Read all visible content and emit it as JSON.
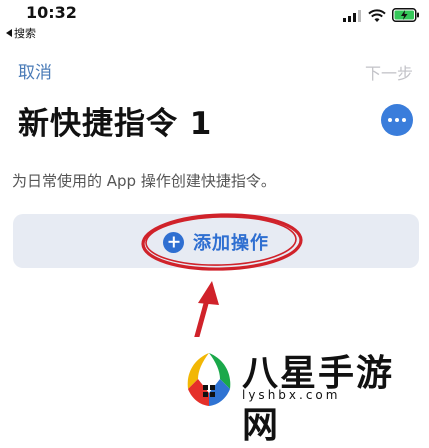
{
  "status_bar": {
    "time": "10:32",
    "back_label": "搜索"
  },
  "nav": {
    "cancel_label": "取消",
    "next_label": "下一步"
  },
  "page": {
    "title": "新快捷指令 1",
    "description": "为日常使用的 App 操作创建快捷指令。"
  },
  "action": {
    "add_label": "添加操作"
  },
  "watermark": {
    "name": "八星手游网",
    "url": "lyshbx.com"
  },
  "colors": {
    "accent": "#2f6fd1",
    "annotation": "#d0222a"
  }
}
